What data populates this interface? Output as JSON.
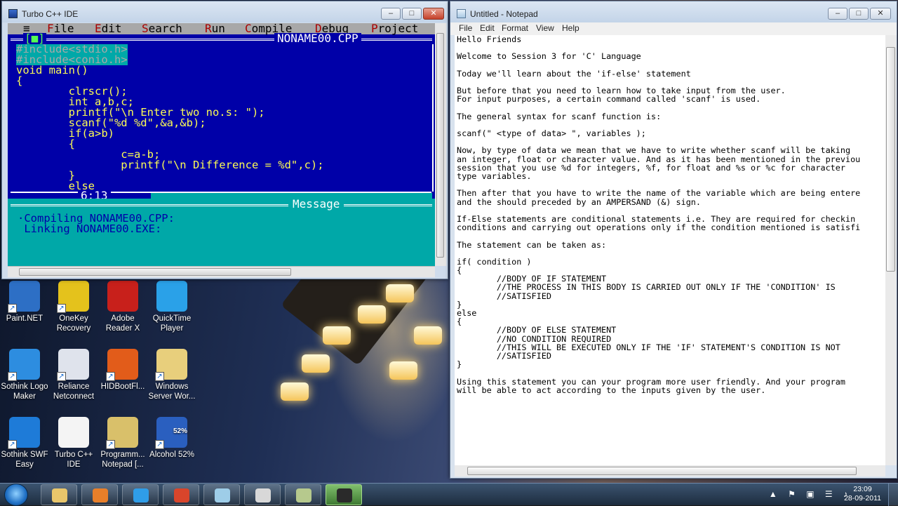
{
  "turboc": {
    "title": "Turbo C++ IDE",
    "menu": [
      "≡",
      "File",
      "Edit",
      "Search",
      "Run",
      "Compile",
      "Debug",
      "Project"
    ],
    "box_marker": "[■]",
    "filename": "NONAME00.CPP",
    "code_lines": [
      "#include<stdio.h>",
      "#include<conio.h>",
      "void main()",
      "{",
      "        clrscr();",
      "        int a,b,c;",
      "        printf(\"\\n Enter two no.s: \");",
      "        scanf(\"%d %d\",&a,&b);",
      "        if(a>b)",
      "        {",
      "                c=a-b;",
      "                printf(\"\\n Difference = %d\",c);",
      "        }",
      "        else"
    ],
    "cursor_pos": "6:13",
    "message_title": "Message",
    "messages": [
      "·Compiling NONAME00.CPP:",
      " Linking NONAME00.EXE:"
    ],
    "buttons": {
      "minimize": "–",
      "maximize": "□",
      "close": "✕"
    }
  },
  "notepad": {
    "title": "Untitled - Notepad",
    "menu": [
      "File",
      "Edit",
      "Format",
      "View",
      "Help"
    ],
    "buttons": {
      "minimize": "–",
      "maximize": "□",
      "close": "✕"
    },
    "lines": [
      "Hello Friends",
      "",
      "Welcome to Session 3 for 'C' Language",
      "",
      "Today we'll learn about the 'if-else' statement",
      "",
      "But before that you need to learn how to take input from the user.",
      "For input purposes, a certain command called 'scanf' is used.",
      "",
      "The general syntax for scanf function is:",
      "",
      "scanf(\" <type of data> \", variables );",
      "",
      "Now, by type of data we mean that we have to write whether scanf will be taking",
      "an integer, float or character value. And as it has been mentioned in the previou",
      "session that you use %d for integers, %f, for float and %s or %c for character",
      "type variables.",
      "",
      "Then after that you have to write the name of the variable which are being entere",
      "and the should preceded by an AMPERSAND (&) sign.",
      "",
      "If-Else statements are conditional statements i.e. They are required for checkin",
      "conditions and carrying out operations only if the condition mentioned is satisfi",
      "",
      "The statement can be taken as:",
      "",
      "if( condition )",
      "{",
      "        //BODY OF IF STATEMENT",
      "        //THE PROCESS IN THIS BODY IS CARRIED OUT ONLY IF THE 'CONDITION' IS",
      "        //SATISFIED",
      "}",
      "else",
      "{",
      "        //BODY OF ELSE STATEMENT",
      "        //NO CONDITION REQUIRED",
      "        //THIS WILL BE EXECUTED ONLY IF THE 'IF' STATEMENT'S CONDITION IS NOT",
      "        //SATISFIED",
      "}",
      "",
      "Using this statement you can your program more user friendly. And your program",
      "will be able to act according to the inputs given by the user."
    ]
  },
  "desktop_icons": [
    {
      "label1": "Paint.NET",
      "label2": "",
      "icon": "paintnet-icon",
      "color": "#2d6fc5"
    },
    {
      "label1": "OneKey",
      "label2": "Recovery",
      "icon": "onekey-recovery-icon",
      "color": "#e4c21c"
    },
    {
      "label1": "Adobe",
      "label2": "Reader X",
      "icon": "adobe-reader-icon",
      "color": "#c8201b"
    },
    {
      "label1": "QuickTime",
      "label2": "Player",
      "icon": "quicktime-icon",
      "color": "#2aa1e8"
    },
    {
      "label1": "Sothink Logo",
      "label2": "Maker",
      "icon": "sothink-logo-icon",
      "color": "#2d8de0"
    },
    {
      "label1": "Reliance",
      "label2": "Netconnect",
      "icon": "reliance-netconnect-icon",
      "color": "#dfe3ec"
    },
    {
      "label1": "HIDBootFl...",
      "label2": "",
      "icon": "hidbootflash-icon",
      "color": "#e25c1a"
    },
    {
      "label1": "Windows",
      "label2": "Server Wor...",
      "icon": "folder-icon",
      "color": "#e8cf7c"
    },
    {
      "label1": "Sothink SWF",
      "label2": "Easy",
      "icon": "sothink-swf-icon",
      "color": "#1e7bd8"
    },
    {
      "label1": "Turbo C++",
      "label2": "IDE",
      "icon": "file-icon",
      "color": "#f4f4f4"
    },
    {
      "label1": "Programm...",
      "label2": "Notepad [...",
      "icon": "programmers-notepad-icon",
      "color": "#d9c06a"
    },
    {
      "label1": "Alcohol 52%",
      "label2": "",
      "icon": "alcohol-icon",
      "color": "#2a5fbf",
      "badge": "52%"
    }
  ],
  "taskbar": {
    "items": [
      {
        "name": "explorer-taskbar-button",
        "icon": "folder-icon",
        "color": "#e9c66b"
      },
      {
        "name": "media-player-taskbar-button",
        "icon": "media-player-icon",
        "color": "#e87f2a"
      },
      {
        "name": "ie-taskbar-button",
        "icon": "internet-explorer-icon",
        "color": "#2f9de8"
      },
      {
        "name": "chrome-taskbar-button",
        "icon": "chrome-icon",
        "color": "#d9452b"
      },
      {
        "name": "notepad-taskbar-button",
        "icon": "notepad-icon",
        "color": "#9ecde8"
      },
      {
        "name": "turboc-taskbar-button",
        "icon": "dos-icon",
        "color": "#d8d8d8"
      },
      {
        "name": "app-taskbar-button",
        "icon": "app-icon",
        "color": "#b6c98d"
      },
      {
        "name": "recorder-taskbar-button",
        "icon": "recorder-icon",
        "color": "#2a2a2a"
      }
    ],
    "tray_icons": "▲ ⚑ ▣ ☰ ♪",
    "time": "23:09",
    "date": "28-09-2011"
  }
}
